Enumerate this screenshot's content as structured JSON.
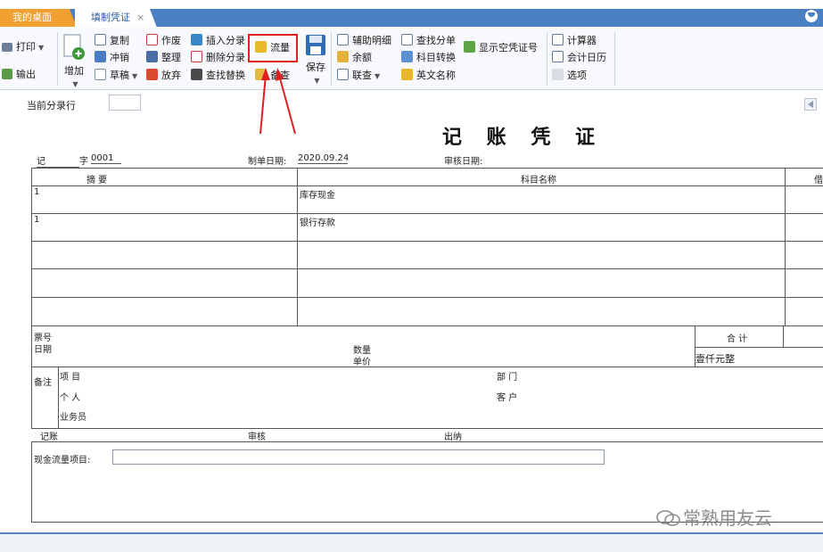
{
  "tabs": {
    "desktop": "我的桌面",
    "voucher": "填制凭证",
    "close_glyph": "×"
  },
  "toolbar": {
    "print": "打印",
    "export": "输出",
    "add": "增加",
    "copy": "复制",
    "reverse": "冲销",
    "draft": "草稿",
    "void": "作废",
    "tidy": "整理",
    "discard": "放弃",
    "insert_entry": "插入分录",
    "delete_entry": "删除分录",
    "find_replace": "查找替换",
    "flow": "流量",
    "spare": "备查",
    "save": "保存",
    "aux_detail": "辅助明细",
    "balance": "余额",
    "linked_query": "联查",
    "find_entry": "查找分单",
    "account_convert": "科目转换",
    "english_name": "英文名称",
    "show_empty_no": "显示空凭证号",
    "calculator": "计算器",
    "calendar": "会计日历",
    "options": "选项"
  },
  "voucher": {
    "current_row_label": "当前分录行",
    "title": "记 账 凭 证",
    "type": "记",
    "zi_label": "字",
    "number": "0001",
    "make_date_label": "制单日期:",
    "make_date": "2020.09.24",
    "audit_date_label": "审核日期:",
    "col_summary": "摘 要",
    "col_account": "科目名称",
    "col_debit": "借",
    "rows": [
      {
        "summary": "1",
        "account": "库存现金"
      },
      {
        "summary": "1",
        "account": "银行存款"
      },
      {
        "summary": "",
        "account": ""
      },
      {
        "summary": "",
        "account": ""
      },
      {
        "summary": "",
        "account": ""
      }
    ],
    "ticket_no": "票号",
    "date": "日期",
    "quantity": "数量",
    "unit_price": "单价",
    "total_label": "合 计",
    "total_text": "壹仟元整",
    "remarks": "备注",
    "project": "项  目",
    "department": "部  门",
    "person": "个  人",
    "customer": "客  户",
    "salesman": "业务员",
    "bookkeeper": "记账",
    "auditor": "审核",
    "cashier": "出纳",
    "cashflow_label": "现金流量项目:"
  },
  "watermark": "常熟用友云",
  "colors": {
    "tab_bar": "#4a7fc1",
    "desktop_tab": "#f0a030",
    "highlight": "#e02020"
  }
}
